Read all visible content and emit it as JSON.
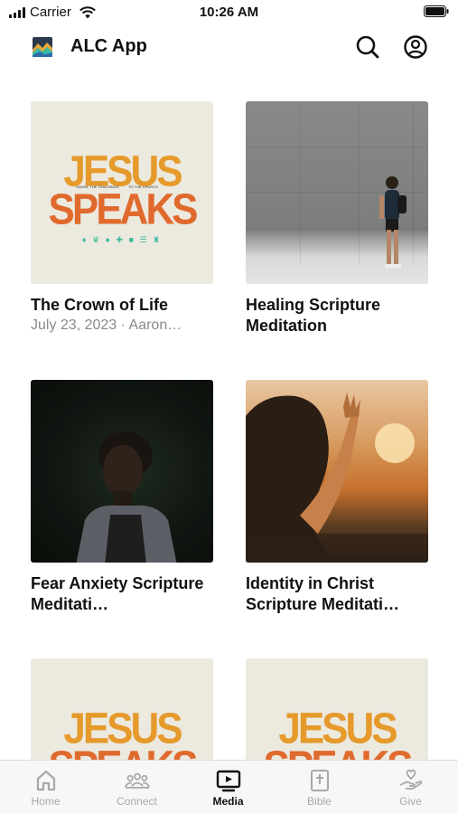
{
  "status_bar": {
    "carrier": "Carrier",
    "time": "10:26 AM"
  },
  "header": {
    "title": "ALC App",
    "logo_icon": "mountain-logo-icon",
    "search_icon": "search-icon",
    "profile_icon": "user-circle-icon"
  },
  "media": {
    "items": [
      {
        "title": "The Crown of Life",
        "subtitle": "July 23, 2023 · Aaron…",
        "artwork": "jesus-speaks",
        "art_text": {
          "line1": "JESUS",
          "line2": "SPEAKS",
          "small_left": "UNVEIL THE TEACHINGS",
          "small_right": "TO THE CHURCH"
        }
      },
      {
        "title": "Healing Scripture Meditation",
        "subtitle": "",
        "artwork": "man-by-concrete-wall"
      },
      {
        "title": "Fear Anxiety Scripture Meditati…",
        "subtitle": "",
        "artwork": "woman-in-dark"
      },
      {
        "title": "Identity in Christ Scripture Meditati…",
        "subtitle": "",
        "artwork": "woman-at-sunset"
      },
      {
        "title": "",
        "subtitle": "",
        "artwork": "jesus-speaks",
        "art_text": {
          "line1": "JESUS",
          "line2": "SPEAKS"
        }
      },
      {
        "title": "",
        "subtitle": "",
        "artwork": "jesus-speaks",
        "art_text": {
          "line1": "JESUS",
          "line2": "SPEAKS"
        }
      }
    ]
  },
  "tabs": [
    {
      "label": "Home",
      "icon": "home-icon",
      "active": false
    },
    {
      "label": "Connect",
      "icon": "group-icon",
      "active": false
    },
    {
      "label": "Media",
      "icon": "tv-play-icon",
      "active": true
    },
    {
      "label": "Bible",
      "icon": "bible-icon",
      "active": false
    },
    {
      "label": "Give",
      "icon": "give-hand-icon",
      "active": false
    }
  ],
  "colors": {
    "tab_inactive": "#a8a8a8",
    "tab_active": "#111111",
    "subtitle": "#8a8a8a",
    "jesus_orange": "#e59a2b",
    "jesus_red": "#e06a2d"
  }
}
